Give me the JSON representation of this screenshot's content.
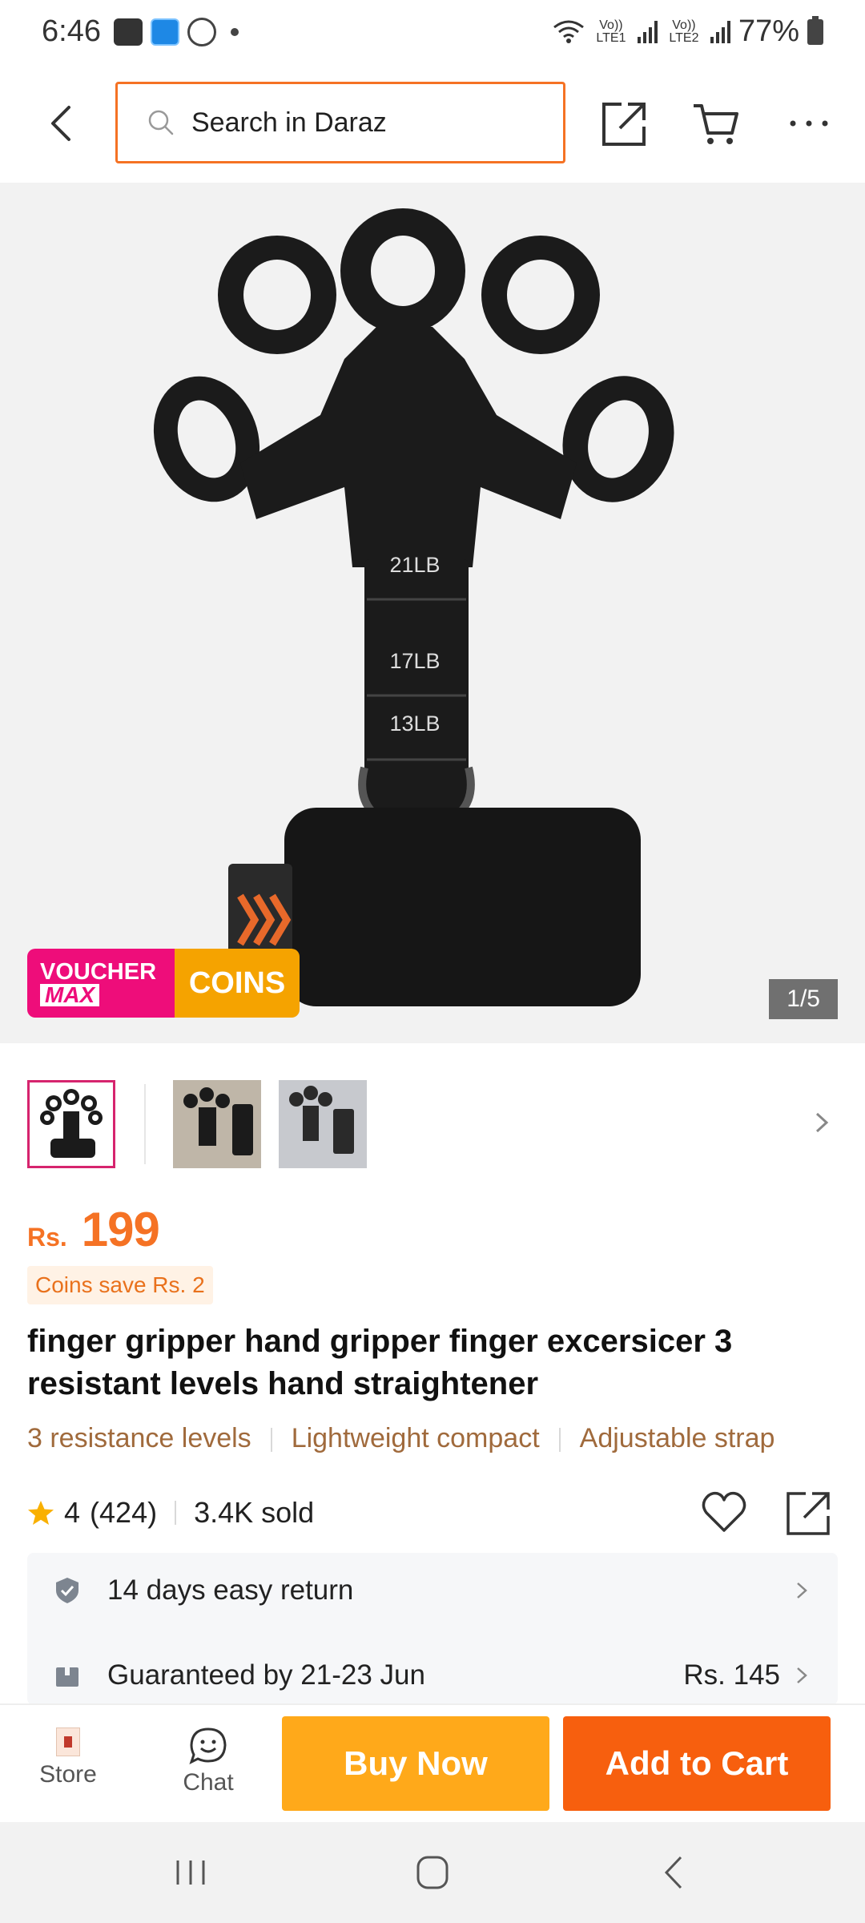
{
  "status_bar": {
    "time": "6:46",
    "battery": "77%",
    "sim1": "Vo)) LTE1",
    "sim2": "Vo)) LTE2"
  },
  "header": {
    "search_placeholder": "Search in Daraz",
    "icons": [
      "back-arrow-icon",
      "search-icon",
      "share-icon",
      "cart-icon",
      "more-icon"
    ]
  },
  "gallery": {
    "counter": "1/5",
    "strap_labels": [
      "21LB",
      "17LB",
      "13LB"
    ],
    "voucher_line1": "VOUCHER",
    "voucher_line2": "MAX",
    "voucher_coins": "COINS",
    "thumbnail_count": 3
  },
  "product": {
    "currency": "Rs.",
    "price": "199",
    "coins_save": "Coins save Rs. 2",
    "title": "finger gripper hand gripper finger excersicer 3 resistant levels hand straightener",
    "highlights": [
      "3 resistance levels",
      "Lightweight compact",
      "Adjustable strap"
    ],
    "rating": "4",
    "reviews": "(424)",
    "sold": "3.4K sold"
  },
  "services": {
    "return_text": "14 days easy return",
    "delivery_text": "Guaranteed by 21-23 Jun",
    "delivery_fee": "Rs. 145"
  },
  "actions": {
    "store_label": "Store",
    "chat_label": "Chat",
    "buy_now": "Buy Now",
    "add_to_cart": "Add to Cart"
  },
  "colors": {
    "accent": "#f57224",
    "buy_now": "#ffa91a",
    "add_to_cart": "#f75f0e",
    "voucher_pink": "#ee0d7a",
    "voucher_gold": "#f5a300"
  }
}
